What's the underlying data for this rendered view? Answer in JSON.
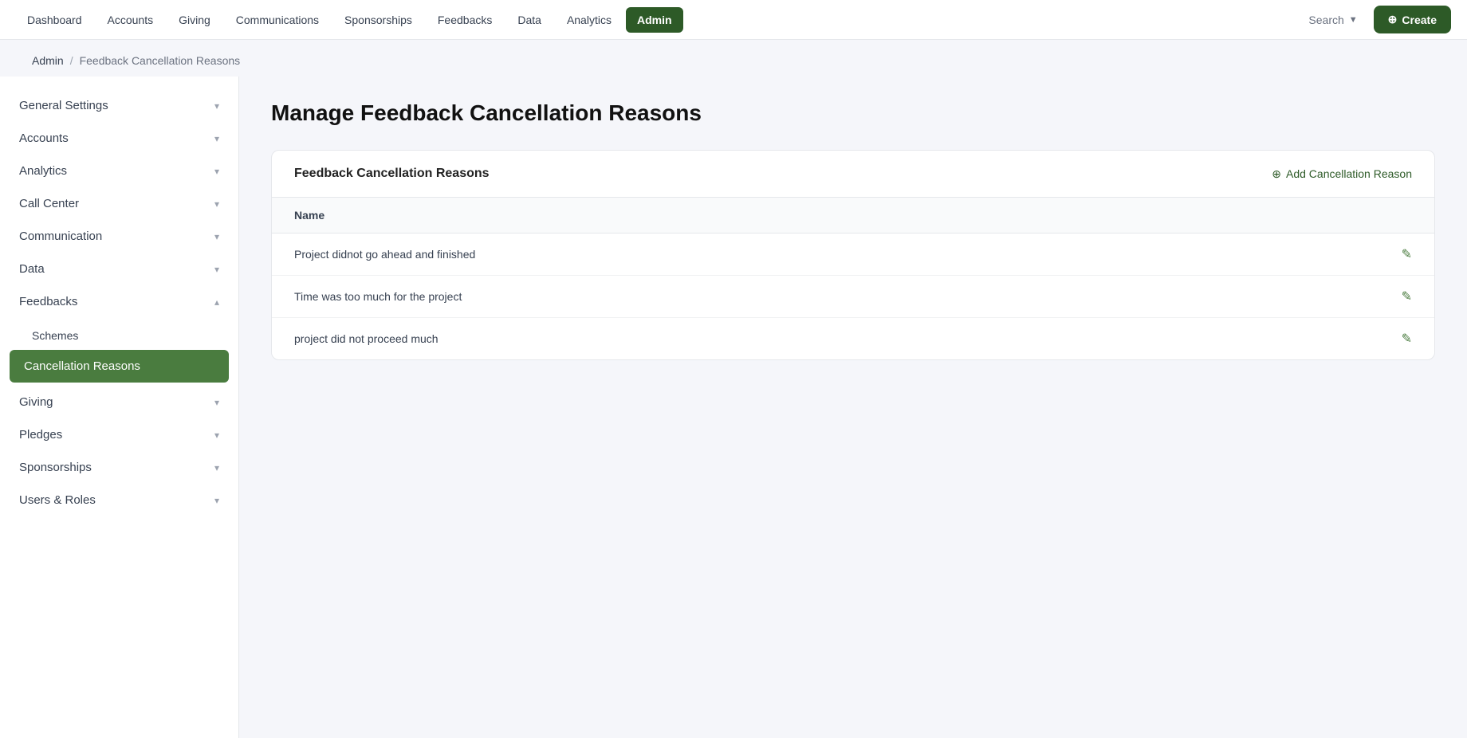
{
  "topNav": {
    "items": [
      {
        "label": "Dashboard",
        "active": false
      },
      {
        "label": "Accounts",
        "active": false
      },
      {
        "label": "Giving",
        "active": false
      },
      {
        "label": "Communications",
        "active": false
      },
      {
        "label": "Sponsorships",
        "active": false
      },
      {
        "label": "Feedbacks",
        "active": false
      },
      {
        "label": "Data",
        "active": false
      },
      {
        "label": "Analytics",
        "active": false
      },
      {
        "label": "Admin",
        "active": true
      }
    ],
    "searchLabel": "Search",
    "createLabel": "Create"
  },
  "breadcrumb": {
    "root": "Admin",
    "separator": "/",
    "current": "Feedback Cancellation Reasons"
  },
  "sidebar": {
    "items": [
      {
        "label": "General Settings",
        "expanded": false,
        "active": false
      },
      {
        "label": "Accounts",
        "expanded": false,
        "active": false
      },
      {
        "label": "Analytics",
        "expanded": false,
        "active": false
      },
      {
        "label": "Call Center",
        "expanded": false,
        "active": false
      },
      {
        "label": "Communication",
        "expanded": false,
        "active": false
      },
      {
        "label": "Data",
        "expanded": false,
        "active": false
      },
      {
        "label": "Feedbacks",
        "expanded": true,
        "active": false
      }
    ],
    "feedbacksSubItems": [
      {
        "label": "Schemes"
      },
      {
        "label": "Cancellation Reasons",
        "active": true
      }
    ],
    "belowItems": [
      {
        "label": "Giving",
        "expanded": false
      },
      {
        "label": "Pledges",
        "expanded": false
      },
      {
        "label": "Sponsorships",
        "expanded": false
      },
      {
        "label": "Users & Roles",
        "expanded": false
      }
    ]
  },
  "main": {
    "pageTitle": "Manage Feedback Cancellation Reasons",
    "card": {
      "title": "Feedback Cancellation Reasons",
      "addBtnLabel": "Add Cancellation Reason",
      "tableHeaders": [
        "Name"
      ],
      "rows": [
        {
          "name": "Project didnot go ahead and finished"
        },
        {
          "name": "Time was too much for the project"
        },
        {
          "name": "project did not proceed much"
        }
      ]
    }
  }
}
